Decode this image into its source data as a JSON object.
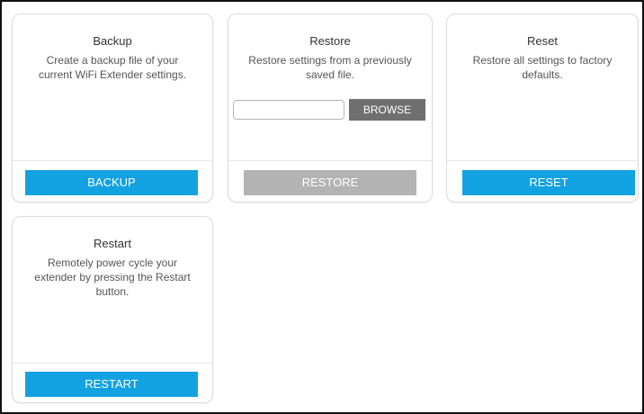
{
  "colors": {
    "primary_button": "#12a2e1",
    "disabled_button": "#b3b3b3",
    "browse_button": "#6f6f6f"
  },
  "cards": {
    "backup": {
      "title": "Backup",
      "desc_lines": [
        "Create a backup file of your",
        "current WiFi Extender settings."
      ],
      "button_label": "BACKUP"
    },
    "restore": {
      "title": "Restore",
      "desc_lines": [
        "Restore settings from a previously",
        "saved file."
      ],
      "file_input_value": "",
      "browse_label": "BROWSE",
      "button_label": "RESTORE"
    },
    "reset": {
      "title": "Reset",
      "desc_lines": [
        "Restore all settings to factory",
        "defaults."
      ],
      "button_label": "RESET"
    },
    "restart": {
      "title": "Restart",
      "desc_lines": [
        "Remotely power cycle your",
        "extender by pressing the Restart",
        "button."
      ],
      "button_label": "RESTART"
    }
  }
}
